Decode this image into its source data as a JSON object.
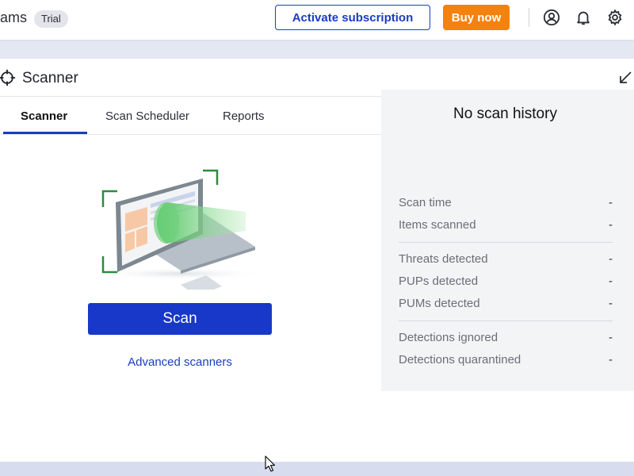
{
  "header": {
    "brand_fragment": "ams",
    "trial_badge": "Trial",
    "activate_label": "Activate subscription",
    "buy_label": "Buy now",
    "icons": [
      "account-icon",
      "bell-icon",
      "gear-icon"
    ],
    "colors": {
      "primary": "#1a3dbf",
      "buy": "#f5810e"
    }
  },
  "panel": {
    "title": "Scanner",
    "tabs": [
      {
        "label": "Scanner",
        "active": true
      },
      {
        "label": "Scan Scheduler",
        "active": false
      },
      {
        "label": "Reports",
        "active": false
      }
    ]
  },
  "scan": {
    "button_label": "Scan",
    "advanced_link": "Advanced scanners"
  },
  "history": {
    "title": "No scan history",
    "groups": [
      [
        {
          "label": "Scan time",
          "value": "-"
        },
        {
          "label": "Items scanned",
          "value": "-"
        }
      ],
      [
        {
          "label": "Threats detected",
          "value": "-"
        },
        {
          "label": "PUPs detected",
          "value": "-"
        },
        {
          "label": "PUMs detected",
          "value": "-"
        }
      ],
      [
        {
          "label": "Detections ignored",
          "value": "-"
        },
        {
          "label": "Detections quarantined",
          "value": "-"
        }
      ]
    ]
  }
}
